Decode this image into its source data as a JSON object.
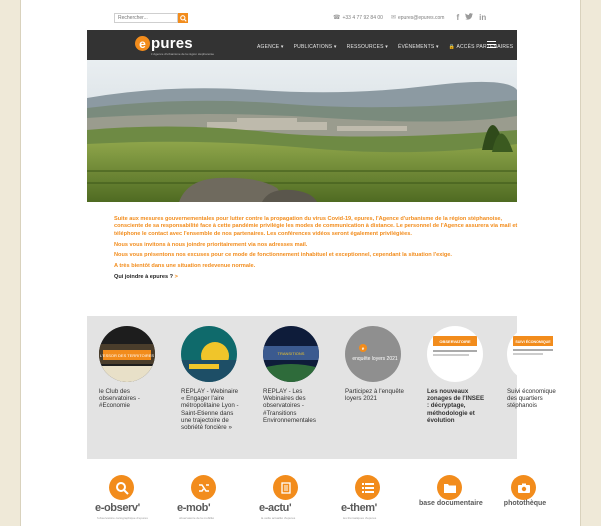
{
  "topbar": {
    "search_placeholder": "Rechercher...",
    "phone": "+33 4 77 92 84 00",
    "email": "epures@epures.com",
    "social": [
      "f",
      "𝑡",
      "in"
    ]
  },
  "brand": {
    "logo_letter": "e",
    "logo_text": "pures",
    "tagline": "L'Agence d'urbanisme de la région stéphanoise"
  },
  "nav": {
    "items": [
      "AGENCE ▾",
      "PUBLICATIONS ▾",
      "RESSOURCES ▾",
      "ÉVÉNEMENTS ▾",
      "🔒 ACCÈS PARTENAIRES"
    ]
  },
  "notice": {
    "p1": "Suite aux mesures gouvernementales pour lutter contre la propagation du virus Covid-19, epures, l'Agence d'urbanisme de la région stéphanoise, consciente de sa responsabilité face à cette pandémie privilégie les modes de communication à distance. Le personnel de l'Agence assurera via mail et téléphone le contact avec l'ensemble de nos partenaires. Les conférences vidéos seront également privilégiées.",
    "p2": "Nous vous invitons à nous joindre prioritairement via nos adresses mail.",
    "p3": "Nous vous présentons nos excuses pour ce mode de fonctionnement inhabituel et exceptionnel, cependant la situation l'exige.",
    "p4": "A très bientôt dans une situation redevenue normale.",
    "who": "Qui joindre à epures ?",
    "who_link": ">"
  },
  "tiles": [
    {
      "label": "le Club des observatoires - #Economie",
      "img_text": "L'ESSOR DES TERRITOIRES"
    },
    {
      "label": "REPLAY - Webinaire « Engager l'aire métropolitaine Lyon - Saint-Etienne dans une trajectoire de sobriété foncière »",
      "img_text": ""
    },
    {
      "label": "REPLAY - Les Webinaires des observatoires - #Transitions Environnementales",
      "img_text": "TRANSITIONS"
    },
    {
      "label": "Participez à l'enquête loyers 2021",
      "img_text": "enquête loyers 2021"
    },
    {
      "label": "Les nouveaux zonages de l'INSEE : décryptage, méthodologie et évolution",
      "img_text": "OBSERVATOIRE"
    },
    {
      "label": "Suivi économique des quartiers stéphanois",
      "img_text": "SUIVI ÉCONOMIQUE"
    }
  ],
  "services": [
    {
      "label": "e-observ'",
      "sub": "l'observatoire cartographique d'epures"
    },
    {
      "label": "e-mob'",
      "sub": "observatoire de la mobilité"
    },
    {
      "label": "e-actu'",
      "sub": "la veille actualité d'epures"
    },
    {
      "label": "e-them'",
      "sub": "les thématiques d'epures"
    },
    {
      "label": "base documentaire",
      "sub": ""
    },
    {
      "label": "photothèque",
      "sub": ""
    }
  ],
  "colors": {
    "accent": "#f28c1c",
    "nav": "#333333",
    "band": "#e3e3e3"
  }
}
